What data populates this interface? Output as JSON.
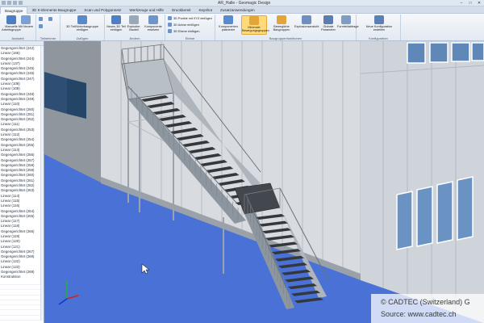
{
  "window": {
    "title": "AR_Halle - Geomagic Design",
    "controls": [
      "–",
      "□",
      "✕"
    ]
  },
  "menu": {
    "tabs": [
      "Baugruppe",
      "3D K-Elemente Baugruppe",
      "Scan und Polygonnetz",
      "Werkzeuge und Hilfe",
      "Druckbereit",
      "Keyshot",
      "Zusatzanwendungen"
    ],
    "active_index": 0
  },
  "ribbon": {
    "buttons": [
      {
        "label": "Manuelle Arbeitsgruppe",
        "color": "#4b7fc4"
      },
      {
        "label": "Mit Neuem",
        "color": "#7aa0d6"
      },
      {
        "label": "3D Teil/Unterbaugruppe einfügen",
        "color": "#5a88c8"
      },
      {
        "label": "Neues 3D Teil einfügen",
        "color": "#4f7fc2"
      },
      {
        "label": "Explodier. Bauteil",
        "color": "#9aa8b8"
      },
      {
        "label": "Komponente ersetzen",
        "color": "#6d95c9"
      },
      {
        "label": "Komponenten platzieren",
        "color": "#5a8bd0"
      },
      {
        "label": "Minimale Bewegungsgruppen",
        "color": "#e3a43a"
      },
      {
        "label": "Bewegliche Baugruppen",
        "color": "#e3a43a"
      },
      {
        "label": "Explosionsansicht",
        "color": "#6f8fc0"
      },
      {
        "label": "Globale Parameter",
        "color": "#5b7db0"
      },
      {
        "label": "Formteilabfrage",
        "color": "#7f9cc3"
      },
      {
        "label": "Neue Konfiguration erstellen",
        "color": "#5c7fb5"
      }
    ],
    "small_items": [
      "3D Punkte mit XYZ einfügen",
      "3D Achse einfügen",
      "3D Ebene einfügen"
    ],
    "group_labels": [
      "Auswahl",
      "Teilnehmer",
      "Zufügen",
      "Ändern",
      "Ebene",
      "Baugruppenfunktionen",
      "Konfiguration"
    ]
  },
  "tree": {
    "items": [
      "Gegengerichtet (242)",
      "Linear (166)",
      "Gegengerichtet (244)",
      "Linear (137)",
      "Gegengerichtet (245)",
      "Gegengerichtet (246)",
      "Gegengerichtet (247)",
      "Linear (108)",
      "Linear (109)",
      "Gegengerichtet (248)",
      "Gegengerichtet (249)",
      "Linear (110)",
      "Gegengerichtet (250)",
      "Gegengerichtet (251)",
      "Gegengerichtet (252)",
      "Linear (111)",
      "Gegengerichtet (253)",
      "Linear (112)",
      "Gegengerichtet (254)",
      "Gegengerichtet (255)",
      "Linear (113)",
      "Gegengerichtet (256)",
      "Gegengerichtet (257)",
      "Gegengerichtet (258)",
      "Gegengerichtet (259)",
      "Gegengerichtet (260)",
      "Gegengerichtet (261)",
      "Gegengerichtet (262)",
      "Gegengerichtet (263)",
      "Linear (114)",
      "Linear (115)",
      "Linear (116)",
      "Gegengerichtet (264)",
      "Gegengerichtet (265)",
      "Linear (117)",
      "Linear (118)",
      "Gegengerichtet (266)",
      "Linear (119)",
      "Linear (120)",
      "Linear (121)",
      "Gegengerichtet (267)",
      "Gegengerichtet (268)",
      "Linear (122)",
      "Linear (123)",
      "Gegengerichtet (269)",
      "Konstruktion"
    ],
    "faded_count": 8
  },
  "watermark": {
    "line1": "© CADTEC (Switzerland) G",
    "line2": "Source: www.cadtec.ch"
  },
  "colors": {
    "floor": "#4c73d6",
    "wall": "#d7dade",
    "stair": "#3b3f44",
    "highlight": "#ffd97a"
  }
}
